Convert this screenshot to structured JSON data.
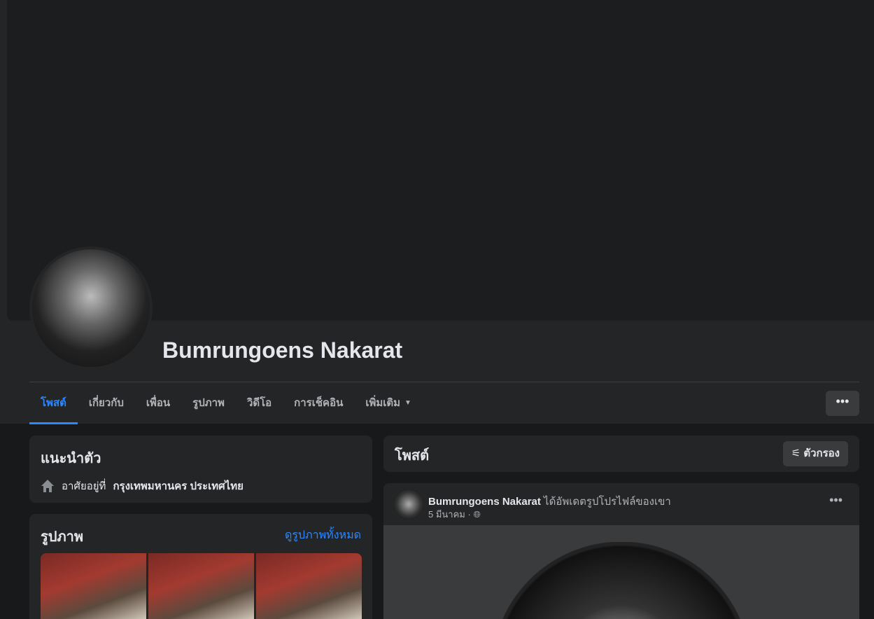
{
  "profile": {
    "name": "Bumrungoens Nakarat"
  },
  "tabs": [
    {
      "label": "โพสต์"
    },
    {
      "label": "เกี่ยวกับ"
    },
    {
      "label": "เพื่อน"
    },
    {
      "label": "รูปภาพ"
    },
    {
      "label": "วิดีโอ"
    },
    {
      "label": "การเช็คอิน"
    },
    {
      "label": "เพิ่มเติม"
    }
  ],
  "more_button": "•••",
  "intro": {
    "title": "แนะนำตัว",
    "lives_prefix": "อาศัยอยู่ที่",
    "lives_place": "กรุงเทพมหานคร ประเทศไทย"
  },
  "photos": {
    "title": "รูปภาพ",
    "see_all": "ดูรูปภาพทั้งหมด"
  },
  "posts": {
    "title": "โพสต์",
    "filter": "ตัวกรอง"
  },
  "post": {
    "author": "Bumrungoens Nakarat",
    "action": "ได้อัพเดตรูปโปรไฟล์ของเขา",
    "date": "5 มีนาคม",
    "sep": "·",
    "menu": "•••"
  }
}
